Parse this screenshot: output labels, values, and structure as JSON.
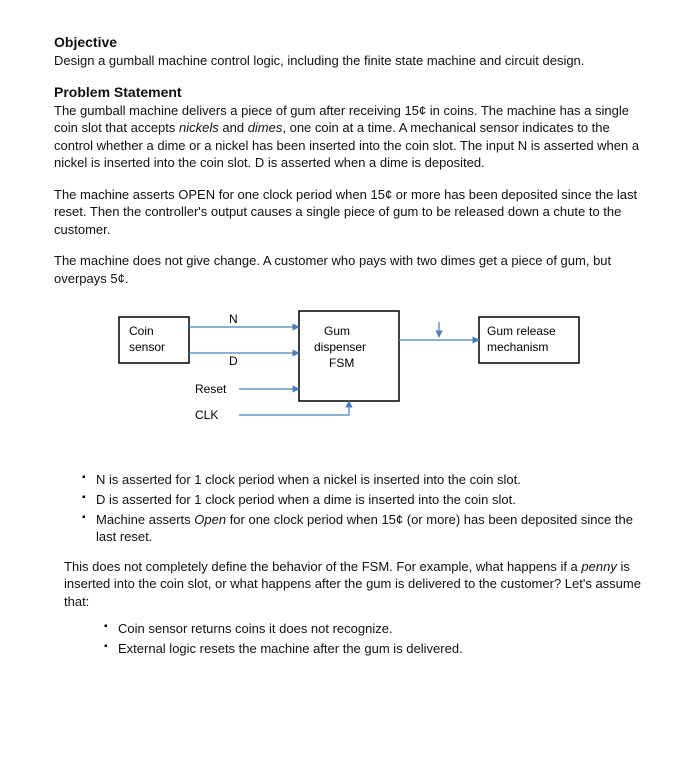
{
  "headings": {
    "objective": "Objective",
    "problem_statement": "Problem Statement"
  },
  "paragraphs": {
    "objective_body": "Design a gumball machine control logic, including the finite state machine and circuit design.",
    "ps1_a": "The gumball machine delivers a piece of gum after receiving 15¢ in coins. The machine has a single coin slot that accepts ",
    "ps1_b": "nickels",
    "ps1_c": " and ",
    "ps1_d": "dimes",
    "ps1_e": ", one coin at a time. A mechanical sensor indicates to the control whether a dime or a nickel has been inserted into the coin slot. The input N is asserted when a nickel is inserted into the coin slot. D is asserted when a dime is deposited.",
    "ps2": "The machine asserts OPEN for one clock period when 15¢ or more has been deposited since the last reset. Then the controller's output causes a single piece of gum to be released down a chute to the customer.",
    "ps3": "The machine does not give change. A customer who pays with two dimes get a piece of gum, but overpays 5¢.",
    "behavior_intro_a": "This does not completely define the behavior of the FSM. For example, what happens if a ",
    "behavior_intro_b": "penny",
    "behavior_intro_c": " is inserted into the coin slot, or what happens after the gum is delivered to the customer? Let's assume that:"
  },
  "bullets": {
    "main": [
      "N is asserted for 1 clock period when a nickel is inserted into the coin slot.",
      "D is asserted for 1 clock period when a dime is inserted into the coin slot."
    ],
    "main_3_a": "Machine asserts ",
    "main_3_b": "Open",
    "main_3_c": " for one clock period when 15¢ (or more) has been deposited since the last reset.",
    "assumptions": [
      "Coin sensor returns coins it does not recognize.",
      "External logic resets the machine after the gum is delivered."
    ]
  },
  "diagram": {
    "coin_sensor_l1": "Coin",
    "coin_sensor_l2": "sensor",
    "fsm_l1": "Gum",
    "fsm_l2": "dispenser",
    "fsm_l3": "FSM",
    "release_l1": "Gum release",
    "release_l2": "mechanism",
    "sig_n": "N",
    "sig_d": "D",
    "sig_reset": "Reset",
    "sig_clk": "CLK"
  }
}
